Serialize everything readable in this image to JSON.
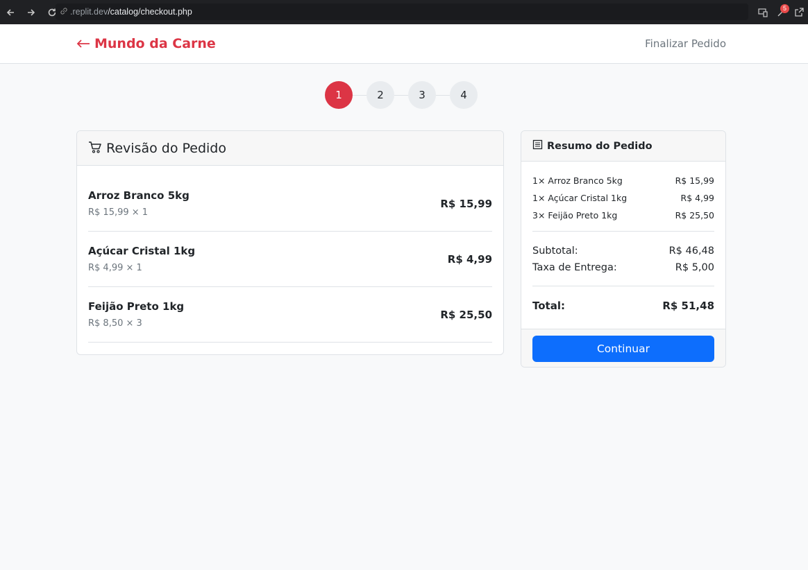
{
  "browser": {
    "url_host": ".replit.dev",
    "url_path": "/catalog/checkout.php",
    "badge_count": "5"
  },
  "header": {
    "brand": "Mundo da Carne",
    "brand_color": "#dc3545",
    "right_link": "Finalizar Pedido"
  },
  "stepper": {
    "steps": [
      "1",
      "2",
      "3",
      "4"
    ],
    "active_step": 1
  },
  "review": {
    "title": "Revisão do Pedido",
    "items": [
      {
        "name": "Arroz Branco 5kg",
        "detail": "R$ 15,99 × 1",
        "total": "R$ 15,99"
      },
      {
        "name": "Açúcar Cristal 1kg",
        "detail": "R$ 4,99 × 1",
        "total": "R$ 4,99"
      },
      {
        "name": "Feijão Preto 1kg",
        "detail": "R$ 8,50 × 3",
        "total": "R$ 25,50"
      }
    ]
  },
  "summary": {
    "title": "Resumo do Pedido",
    "lines": [
      {
        "label": "1× Arroz Branco 5kg",
        "value": "R$ 15,99"
      },
      {
        "label": "1× Açúcar Cristal 1kg",
        "value": "R$ 4,99"
      },
      {
        "label": "3× Feijão Preto 1kg",
        "value": "R$ 25,50"
      }
    ],
    "subtotal_label": "Subtotal:",
    "subtotal_value": "R$ 46,48",
    "delivery_label": "Taxa de Entrega:",
    "delivery_value": "R$ 5,00",
    "total_label": "Total:",
    "total_value": "R$ 51,48",
    "continue_label": "Continuar",
    "button_color": "#0d6efd"
  },
  "icons": {
    "back": "arrow-left-icon",
    "forward": "arrow-right-icon",
    "reload": "reload-icon",
    "link": "link-icon",
    "cart": "cart-icon",
    "receipt": "receipt-icon"
  }
}
